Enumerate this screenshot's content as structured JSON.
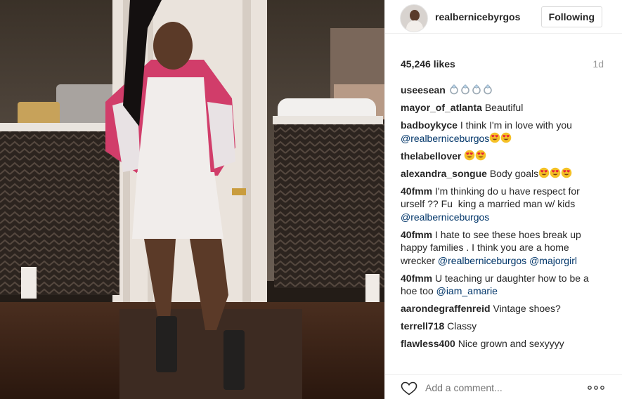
{
  "post": {
    "username": "realbernicebyrgos",
    "follow_label": "Following",
    "likes": "45,246 likes",
    "age": "1d"
  },
  "comments": [
    {
      "user": "useesean",
      "parts": [
        {
          "t": "emoji",
          "icon": "diamond-emoji",
          "count": 4
        }
      ]
    },
    {
      "user": "mayor_of_atlanta",
      "parts": [
        {
          "t": "text",
          "v": "Beautiful"
        }
      ]
    },
    {
      "user": "badboykyce",
      "parts": [
        {
          "t": "text",
          "v": "I think I'm in love with you "
        },
        {
          "t": "mention",
          "v": "@realberniceburgos"
        },
        {
          "t": "emoji",
          "icon": "heart-eyes-emoji",
          "count": 2
        }
      ]
    },
    {
      "user": "thelabellover",
      "parts": [
        {
          "t": "emoji",
          "icon": "heart-eyes-emoji",
          "count": 2
        }
      ]
    },
    {
      "user": "alexandra_songue",
      "parts": [
        {
          "t": "text",
          "v": "Body goals"
        },
        {
          "t": "emoji",
          "icon": "heart-eyes-emoji",
          "count": 3
        }
      ]
    },
    {
      "user": "40fmm",
      "parts": [
        {
          "t": "text",
          "v": "I'm thinking do u have respect for urself ?? Fu  king a married man w/ kids "
        },
        {
          "t": "mention",
          "v": "@realberniceburgos"
        }
      ]
    },
    {
      "user": "40fmm",
      "parts": [
        {
          "t": "text",
          "v": "I hate to see these hoes break up happy families . I think you are a home wrecker "
        },
        {
          "t": "mention",
          "v": "@realberniceburgos"
        },
        {
          "t": "text",
          "v": " "
        },
        {
          "t": "mention",
          "v": "@majorgirl"
        }
      ]
    },
    {
      "user": "40fmm",
      "parts": [
        {
          "t": "text",
          "v": "U teaching ur daughter how to be a hoe too "
        },
        {
          "t": "mention",
          "v": "@iam_amarie"
        }
      ]
    },
    {
      "user": "aarondegraffenreid",
      "parts": [
        {
          "t": "text",
          "v": "Vintage shoes?"
        }
      ]
    },
    {
      "user": "terrell718",
      "parts": [
        {
          "t": "text",
          "v": "Classy"
        }
      ]
    },
    {
      "user": "flawless400",
      "parts": [
        {
          "t": "text",
          "v": "Nice grown and sexyyyy"
        }
      ]
    }
  ],
  "footer": {
    "placeholder": "Add a comment...",
    "like_icon": "heart-outline-icon",
    "more_icon": "more-horizontal-icon"
  },
  "colors": {
    "text": "#262626",
    "mention": "#003569",
    "muted": "#999999",
    "border": "#efefef",
    "emoji_face": "#f5c026",
    "emoji_heart": "#e8213a",
    "diamond": "#b9d3e8"
  }
}
